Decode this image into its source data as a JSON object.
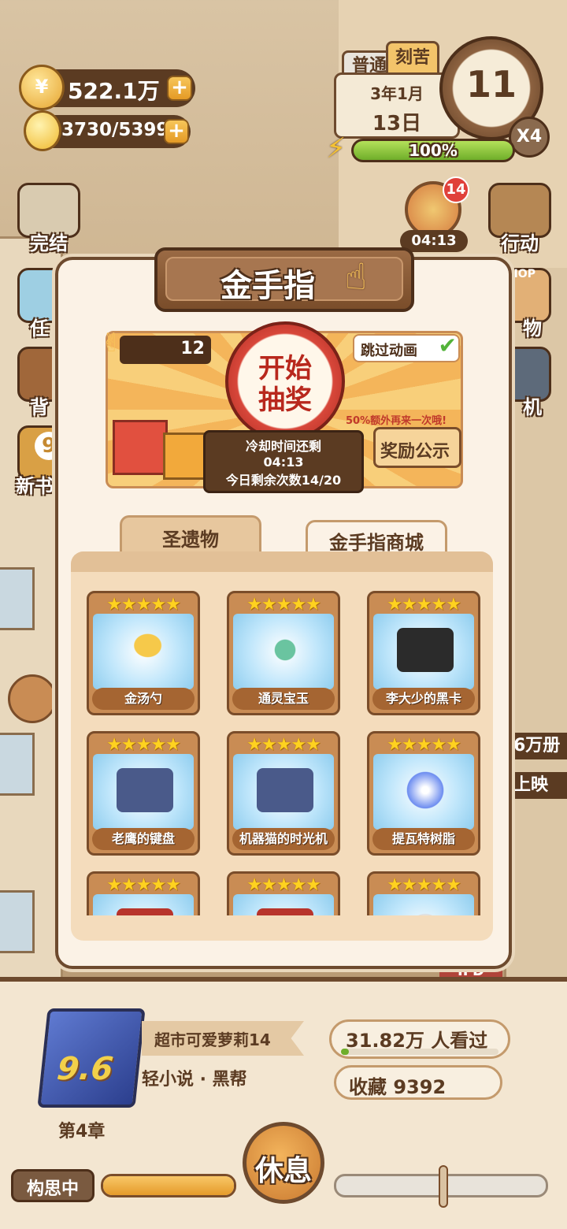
{
  "hud": {
    "coins": "522.1万",
    "energy": "3730/5399",
    "mode_tabs": [
      "普通",
      "刻苦"
    ],
    "date_month": "3年1月",
    "date_day": "13日",
    "hour": "11",
    "speed": "X4",
    "stamina_pct": "100%",
    "stamina_fraction": 1.0
  },
  "side_left": [
    "完结",
    "任",
    "背",
    "新书"
  ],
  "side_left_badge": "9",
  "side_right": [
    "行动",
    "物",
    "机"
  ],
  "side_right_top_badge": "14",
  "side_right_timer": "04:13",
  "shop_sign": "SHOP",
  "behind_texts": [
    "6万册",
    "上映",
    "IFD"
  ],
  "dialog": {
    "title": "金手指",
    "draw_count": "12",
    "skip_animation": "跳过动画",
    "draw_button": "开始抽奖",
    "bonus_text": "50%额外再来一次哦!",
    "cooldown_label": "冷却时间还剩",
    "cooldown_time": "04:13",
    "remaining_today": "今日剩余次数14/20",
    "rewards_button": "奖励公示",
    "tabs": [
      "圣遗物",
      "金手指商城"
    ],
    "stars": "★★★★★",
    "items": [
      {
        "name": "金汤勺",
        "icon": "golden-spoon-icon"
      },
      {
        "name": "通灵宝玉",
        "icon": "jade-pendant-icon"
      },
      {
        "name": "李大少的黑卡",
        "icon": "vip-card-icon"
      },
      {
        "name": "老鹰的键盘",
        "icon": "keyboard-icon"
      },
      {
        "name": "机器猫的时光机",
        "icon": "time-machine-icon"
      },
      {
        "name": "提瓦特树脂",
        "icon": "resin-orb-icon"
      },
      {
        "name": "",
        "icon": "red-book-icon"
      },
      {
        "name": "",
        "icon": "red-item-icon"
      },
      {
        "name": "",
        "icon": "bun-icon"
      }
    ]
  },
  "book": {
    "title": "超市可爱萝莉14",
    "genre": "轻小说 · 黑帮",
    "score": "9.6",
    "chapter": "第4章",
    "views": "31.82万 人看过",
    "favorites": "收藏 9392",
    "views_fraction": 0.05
  },
  "bottom": {
    "status": "构思中",
    "rest_button": "休息",
    "progress_fraction": 1.0
  }
}
